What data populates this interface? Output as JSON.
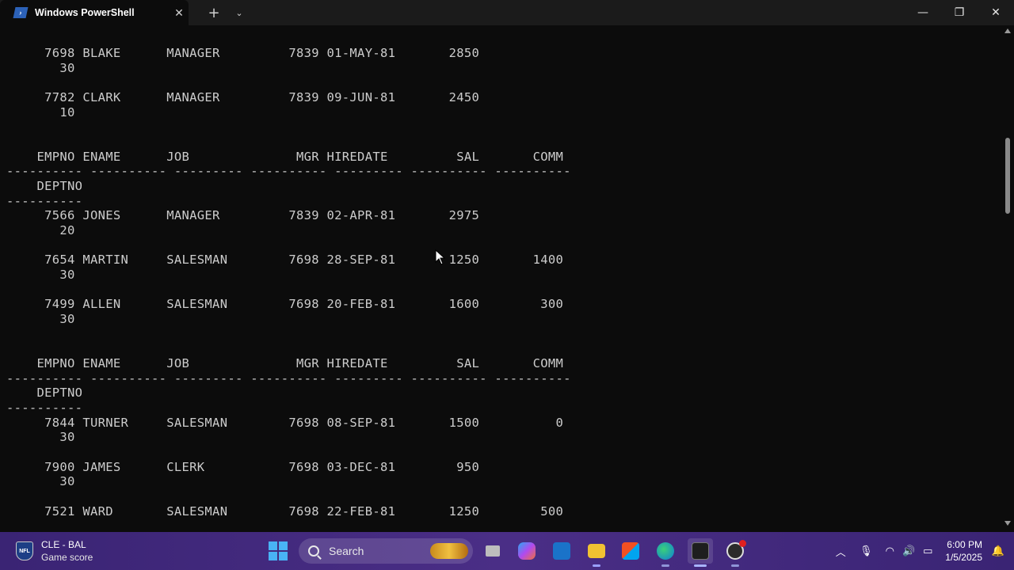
{
  "window": {
    "tab_title": "Windows PowerShell",
    "tab_close": "✕",
    "new_tab": "+",
    "dropdown": "⌄",
    "minimize": "—",
    "maximize": "❐",
    "close": "✕"
  },
  "terminal": {
    "lines": [
      "     7698 BLAKE      MANAGER         7839 01-MAY-81       2850",
      "       30",
      "",
      "     7782 CLARK      MANAGER         7839 09-JUN-81       2450",
      "       10",
      "",
      "",
      "    EMPNO ENAME      JOB              MGR HIREDATE         SAL       COMM",
      "---------- ---------- --------- ---------- --------- ---------- ----------",
      "    DEPTNO",
      "----------",
      "     7566 JONES      MANAGER         7839 02-APR-81       2975",
      "       20",
      "",
      "     7654 MARTIN     SALESMAN        7698 28-SEP-81       1250       1400",
      "       30",
      "",
      "     7499 ALLEN      SALESMAN        7698 20-FEB-81       1600        300",
      "       30",
      "",
      "",
      "    EMPNO ENAME      JOB              MGR HIREDATE         SAL       COMM",
      "---------- ---------- --------- ---------- --------- ---------- ----------",
      "    DEPTNO",
      "----------",
      "     7844 TURNER     SALESMAN        7698 08-SEP-81       1500          0",
      "       30",
      "",
      "     7900 JAMES      CLERK           7698 03-DEC-81        950",
      "       30",
      "",
      "     7521 WARD       SALESMAN        7698 22-FEB-81       1250        500"
    ]
  },
  "taskbar": {
    "widget_title": "CLE - BAL",
    "widget_subtitle": "Game score",
    "search_label": "Search",
    "clock_time": "6:00 PM",
    "clock_date": "1/5/2025",
    "tray_chevron": "︿",
    "tray_mic": "🎙",
    "tray_wifi": "◠",
    "tray_volume": "🔊",
    "tray_battery": "▭",
    "tray_notify": "🔔"
  },
  "colors": {
    "terminal_bg": "#0c0c0c",
    "terminal_fg": "#cccccc",
    "taskbar_bg": "#3f2a7c",
    "titlebar_bg": "#1b1b1b"
  }
}
